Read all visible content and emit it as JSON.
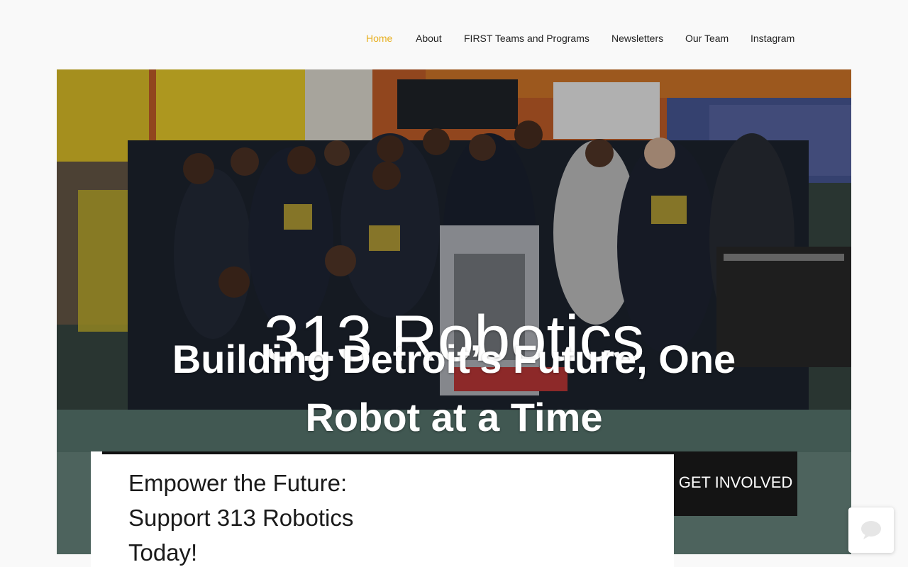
{
  "nav": {
    "items": [
      {
        "label": "Home",
        "active": true
      },
      {
        "label": "About",
        "active": false
      },
      {
        "label": "FIRST Teams and Programs",
        "active": false
      },
      {
        "label": "Newsletters",
        "active": false
      },
      {
        "label": "Our Team",
        "active": false
      },
      {
        "label": "Instagram",
        "active": false
      }
    ]
  },
  "hero": {
    "title": "313 Robotics",
    "subtitle": "Building Detroit’s Future, One Robot at a Time",
    "image_icon": "team-photo-image"
  },
  "cta": {
    "text": "Empower the Future: Support 313 Robotics Today!",
    "button_label": "GET INVOLVED"
  },
  "chat": {
    "icon": "chat-bubble-icon"
  },
  "colors": {
    "background": "#f9f9f9",
    "nav_active": "#e8b021",
    "nav_text": "#222222",
    "cta_button": "#141414",
    "cta_panel": "#ffffff"
  }
}
